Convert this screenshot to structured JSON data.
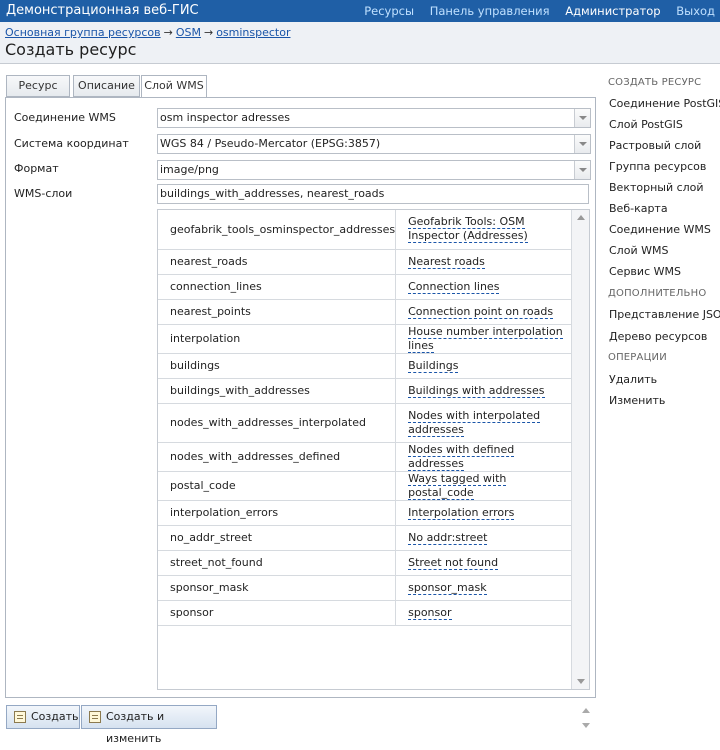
{
  "header": {
    "app_title": "Демонстрационная веб-ГИС",
    "nav": {
      "resources": "Ресурсы",
      "control_panel": "Панель управления",
      "user": "Администратор",
      "logout": "Выход"
    }
  },
  "breadcrumb": {
    "items": [
      "Основная группа ресурсов",
      "OSM",
      "osminspector"
    ],
    "separator": "→"
  },
  "page_title": "Создать ресурс",
  "tabs": [
    "Ресурс",
    "Описание",
    "Слой WMS"
  ],
  "form": {
    "connection_label": "Соединение WMS",
    "connection_value": "osm inspector adresses",
    "crs_label": "Система координат",
    "crs_value": "WGS 84 / Pseudo-Mercator (EPSG:3857)",
    "format_label": "Формат",
    "format_value": "image/png",
    "layers_label": "WMS-слои",
    "layers_value": "buildings_with_addresses, nearest_roads"
  },
  "wms_layers": [
    {
      "key": "geofabrik_tools_osminspector_addresses",
      "title": "Geofabrik Tools: OSM Inspector (Addresses)"
    },
    {
      "key": "nearest_roads",
      "title": "Nearest roads"
    },
    {
      "key": "connection_lines",
      "title": "Connection lines"
    },
    {
      "key": "nearest_points",
      "title": "Connection point on roads"
    },
    {
      "key": "interpolation",
      "title": "House number interpolation lines"
    },
    {
      "key": "buildings",
      "title": "Buildings"
    },
    {
      "key": "buildings_with_addresses",
      "title": "Buildings with addresses"
    },
    {
      "key": "nodes_with_addresses_interpolated",
      "title": "Nodes with interpolated addresses"
    },
    {
      "key": "nodes_with_addresses_defined",
      "title": "Nodes with defined addresses"
    },
    {
      "key": "postal_code",
      "title": "Ways tagged with postal_code"
    },
    {
      "key": "interpolation_errors",
      "title": "Interpolation errors"
    },
    {
      "key": "no_addr_street",
      "title": "No addr:street"
    },
    {
      "key": "street_not_found",
      "title": "Street not found"
    },
    {
      "key": "sponsor_mask",
      "title": "sponsor_mask"
    },
    {
      "key": "sponsor",
      "title": "sponsor"
    }
  ],
  "sidebar": {
    "create_heading": "СОЗДАТЬ РЕСУРС",
    "create_items": [
      "Соединение PostGIS",
      "Слой PostGIS",
      "Растровый слой",
      "Группа ресурсов",
      "Векторный слой",
      "Веб-карта",
      "Соединение WMS",
      "Слой WMS",
      "Сервис WMS"
    ],
    "extra_heading": "ДОПОЛНИТЕЛЬНО",
    "extra_items": [
      "Представление JSON",
      "Дерево ресурсов"
    ],
    "ops_heading": "ОПЕРАЦИИ",
    "ops_items": [
      "Удалить",
      "Изменить"
    ]
  },
  "buttons": {
    "create": "Создать",
    "create_and_edit": "Создать и изменить"
  },
  "colors": {
    "header_bg": "#1f5fa6",
    "link": "#1a55a8"
  }
}
